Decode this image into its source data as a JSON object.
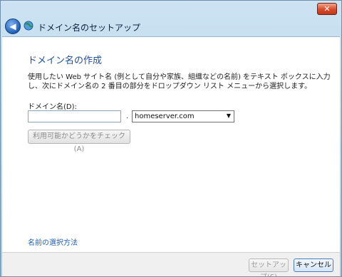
{
  "window": {
    "close_glyph": "✕"
  },
  "nav": {
    "back_glyph": "◀",
    "title": "ドメイン名のセットアップ"
  },
  "page": {
    "heading": "ドメイン名の作成",
    "description": "使用したい Web サイト名 (例として自分や家族、組織などの名前) をテキスト ボックスに入力し、次にドメイン名の 2 番目の部分をドロップダウン リスト メニューから選択します。",
    "domain_label": "ドメイン名(D):",
    "domain_value": "",
    "separator": ".",
    "domain_suffix_selected": "homeserver.com",
    "check_button": "利用可能かどうかをチェック(A)",
    "help_link": "名前の選択方法"
  },
  "footer": {
    "setup_button": "セットアップ(S)",
    "cancel_button": "キャンセル"
  },
  "icons": {
    "back": "back-arrow-icon",
    "globe": "globe-icon",
    "close": "close-icon",
    "dropdown": "chevron-down-icon"
  },
  "colors": {
    "heading": "#1f4f9a",
    "link": "#1f5db3",
    "close_button": "#d84a2c"
  }
}
